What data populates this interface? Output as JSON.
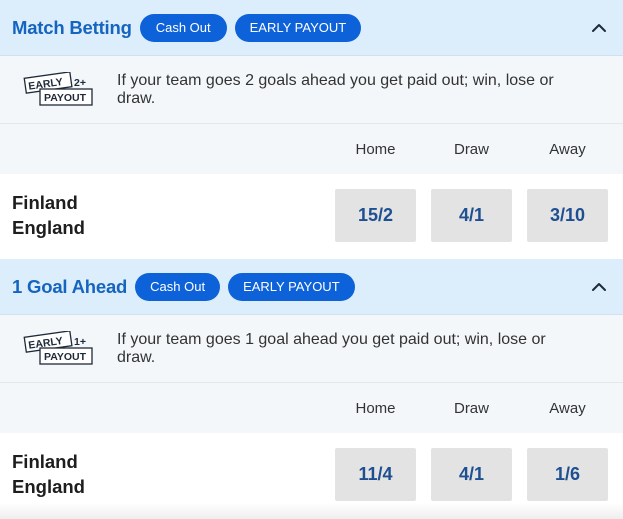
{
  "markets": [
    {
      "title": "Match Betting",
      "cash_out_label": "Cash Out",
      "early_payout_label": "EARLY PAYOUT",
      "badge": {
        "line1": "EARLY",
        "line2": "PAYOUT",
        "goals": "2+"
      },
      "description": "If your team goes 2 goals ahead you get paid out; win, lose or draw.",
      "columns": [
        "Home",
        "Draw",
        "Away"
      ],
      "teams": [
        "Finland",
        "England"
      ],
      "odds": [
        "15/2",
        "4/1",
        "3/10"
      ]
    },
    {
      "title": "1 Goal Ahead",
      "cash_out_label": "Cash Out",
      "early_payout_label": "EARLY PAYOUT",
      "badge": {
        "line1": "EARLY",
        "line2": "PAYOUT",
        "goals": "1+"
      },
      "description": "If your team goes 1 goal ahead you get paid out; win, lose or draw.",
      "columns": [
        "Home",
        "Draw",
        "Away"
      ],
      "teams": [
        "Finland",
        "England"
      ],
      "odds": [
        "11/4",
        "4/1",
        "1/6"
      ]
    }
  ],
  "icons": {
    "collapse": "chevron-up-icon",
    "badge": "early-payout-badge-icon"
  },
  "colors": {
    "accent": "#0d62d9",
    "title": "#1565c0",
    "header_bg": "#dcedfb",
    "odds_text": "#1d4f91",
    "odds_bg": "#e3e3e3"
  }
}
